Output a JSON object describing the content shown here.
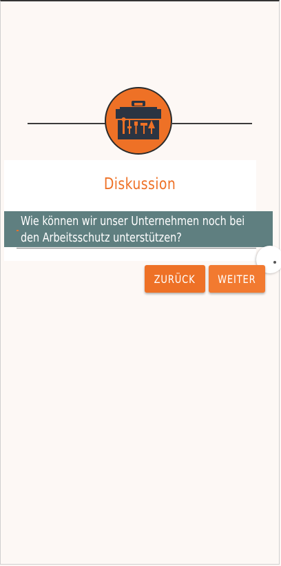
{
  "card": {
    "title": "Diskussion",
    "question": "Wie können wir unser Unternehmen noch bei den Arbeitsschutz unterstützen?"
  },
  "buttons": {
    "back": "ZURÜCK",
    "next": "WEITER"
  },
  "colors": {
    "accent": "#ee7126",
    "question_band": "#5f7f80",
    "background": "#fdf8f5"
  },
  "icons": {
    "logo": "toolbox-icon"
  }
}
